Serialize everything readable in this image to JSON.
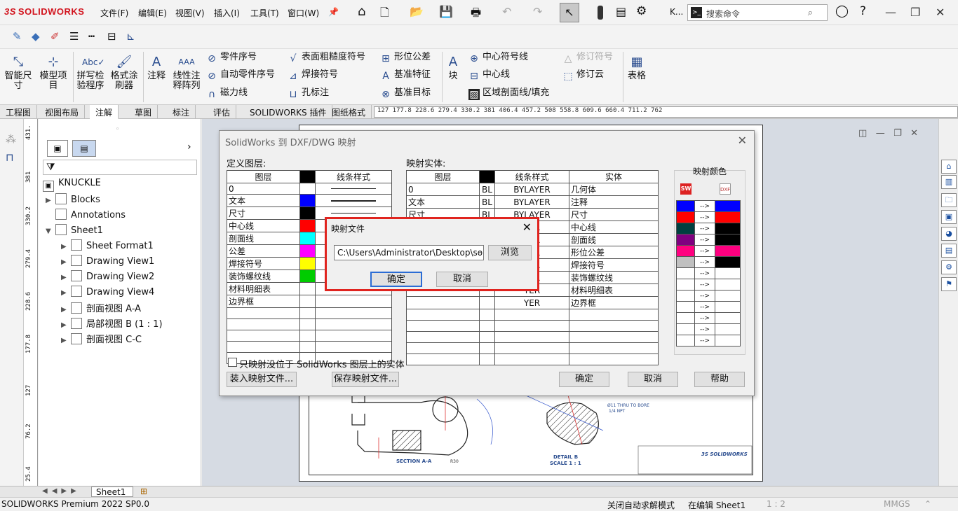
{
  "app": {
    "logo": "SOLIDWORKS",
    "logo_mark": "3S"
  },
  "menus": [
    "文件(F)",
    "编辑(E)",
    "视图(V)",
    "插入(I)",
    "工具(T)",
    "窗口(W)"
  ],
  "toolbar": {
    "doc_short": "K..."
  },
  "search": {
    "placeholder": "搜索命令"
  },
  "ribbon": {
    "smart_dim": "智能尺\n寸",
    "model_items": "模型项\n目",
    "spell": "拼写检\n验程序",
    "format_painter": "格式涂\n刷器",
    "note": "注释",
    "linear_note": "线性注\n释阵列",
    "balloon": "零件序号",
    "auto_balloon": "自动零件序号",
    "magnetic_line": "磁力线",
    "surface_finish": "表面粗糙度符号",
    "weld": "焊接符号",
    "hole_callout": "孔标注",
    "gtol": "形位公差",
    "datum_feature": "基准特征",
    "datum_target": "基准目标",
    "block": "块",
    "center_mark": "中心符号线",
    "centerline": "中心线",
    "area_hatch": "区域剖面线/填充",
    "revision_symbol": "修订符号",
    "revision_cloud": "修订云",
    "table": "表格"
  },
  "cmd_tabs": [
    "工程图",
    "视图布局",
    "注解",
    "草图",
    "标注",
    "评估",
    "SOLIDWORKS 插件",
    "图纸格式"
  ],
  "active_tab_index": 2,
  "hruler_text": "127      177.8      228.6      279.4      330.2      381 406.4      457.2      508      558.8      609.6      660.4      711.2      762",
  "vruler_labels": [
    "431.",
    "381",
    "330.2",
    "279.4",
    "228.6",
    "177.8",
    "127",
    "76.2",
    "25.4"
  ],
  "tree": {
    "root": "KNUCKLE",
    "items": [
      {
        "label": "Blocks",
        "level": 1,
        "expander": "▶",
        "icon": "folder-icon"
      },
      {
        "label": "Annotations",
        "level": 1,
        "expander": "",
        "icon": "annotation-icon"
      },
      {
        "label": "Sheet1",
        "level": 1,
        "expander": "▼",
        "icon": "sheet-icon"
      },
      {
        "label": "Sheet Format1",
        "level": 2,
        "expander": "▶",
        "icon": "sheet-format-icon"
      },
      {
        "label": "Drawing View1",
        "level": 2,
        "expander": "▶",
        "icon": "drawing-view-icon"
      },
      {
        "label": "Drawing View2",
        "level": 2,
        "expander": "▶",
        "icon": "drawing-view-icon"
      },
      {
        "label": "Drawing View4",
        "level": 2,
        "expander": "▶",
        "icon": "drawing-view-icon"
      },
      {
        "label": "剖面视图 A-A",
        "level": 2,
        "expander": "▶",
        "icon": "section-view-icon"
      },
      {
        "label": "局部视图 B (1 : 1)",
        "level": 2,
        "expander": "▶",
        "icon": "detail-view-icon"
      },
      {
        "label": "剖面视图 C-C",
        "level": 2,
        "expander": "▶",
        "icon": "section-view-icon"
      }
    ]
  },
  "dxf_dialog": {
    "title": "SolidWorks 到 DXF/DWG 映射",
    "define_layers": "定义图层:",
    "layers_headers": [
      "图层",
      "",
      "线条样式"
    ],
    "layers": [
      {
        "name": "0",
        "color": "#ffffff"
      },
      {
        "name": "文本",
        "color": "#0000ff"
      },
      {
        "name": "尺寸",
        "color": "#000000"
      },
      {
        "name": "中心线",
        "color": "#ff0000"
      },
      {
        "name": "剖面线",
        "color": "#00ffff"
      },
      {
        "name": "公差",
        "color": "#ff00ff"
      },
      {
        "name": "焊接符号",
        "color": "#ffff00"
      },
      {
        "name": "装饰螺纹线",
        "color": "#00cc00"
      },
      {
        "name": "材料明细表",
        "color": "#ffffff"
      },
      {
        "name": "边界框",
        "color": "#ffffff"
      }
    ],
    "map_entities": "映射实体:",
    "entity_headers": [
      "图层",
      "",
      "线条样式",
      "实体"
    ],
    "entities": [
      {
        "layer": "0",
        "color": "BL",
        "style": "BYLAYER",
        "entity": "几何体"
      },
      {
        "layer": "文本",
        "color": "BL",
        "style": "BYLAYER",
        "entity": "注释"
      },
      {
        "layer": "尺寸",
        "color": "BL",
        "style": "BYLAYER",
        "entity": "尺寸"
      },
      {
        "layer": "",
        "color": "",
        "style": "YER",
        "entity": "中心线"
      },
      {
        "layer": "",
        "color": "",
        "style": "YER",
        "entity": "剖面线"
      },
      {
        "layer": "",
        "color": "",
        "style": "YER",
        "entity": "形位公差"
      },
      {
        "layer": "",
        "color": "",
        "style": "YER",
        "entity": "焊接符号"
      },
      {
        "layer": "",
        "color": "",
        "style": "YER",
        "entity": "装饰螺纹线"
      },
      {
        "layer": "",
        "color": "",
        "style": "YER",
        "entity": "材料明细表"
      },
      {
        "layer": "",
        "color": "",
        "style": "YER",
        "entity": "边界框"
      }
    ],
    "map_colors_title": "映射颜色",
    "color_map": [
      {
        "from": "#0000ff",
        "to": "#0000ff"
      },
      {
        "from": "#ff0000",
        "to": "#ff0000"
      },
      {
        "from": "#004040",
        "to": "#000000"
      },
      {
        "from": "#800080",
        "to": "#000000"
      },
      {
        "from": "#ff0080",
        "to": "#ff0080"
      },
      {
        "from": "#c0c0c0",
        "to": "#000000"
      },
      {
        "from": "#ffffff",
        "to": "#ffffff"
      },
      {
        "from": "#ffffff",
        "to": "#ffffff"
      },
      {
        "from": "#ffffff",
        "to": "#ffffff"
      },
      {
        "from": "#ffffff",
        "to": "#ffffff"
      },
      {
        "from": "#ffffff",
        "to": "#ffffff"
      },
      {
        "from": "#ffffff",
        "to": "#ffffff"
      },
      {
        "from": "#ffffff",
        "to": "#ffffff"
      }
    ],
    "arrow": "-->",
    "checkbox_label": "只映射没位于 SolidWorks 图层上的实体",
    "load_btn": "装入映射文件...",
    "save_btn": "保存映射文件...",
    "ok": "确定",
    "cancel": "取消",
    "help": "帮助"
  },
  "map_file_dialog": {
    "title": "映射文件",
    "path": "C:\\Users\\Administrator\\Desktop\\solid",
    "browse": "浏览",
    "ok": "确定",
    "cancel": "取消"
  },
  "drawing": {
    "section_label": "SECTION A-A",
    "detail_label": "DETAIL B",
    "detail_scale": "SCALE 1 : 1",
    "note1": "Ø11 THRU TO BORE",
    "note2": "1/4 NPT",
    "dim_r": "R30",
    "tb_logo": "3S SOLIDWORKS"
  },
  "sheet_tab": "Sheet1",
  "status": {
    "product": "SOLIDWORKS Premium 2022 SP0.0",
    "auto_solve": "关闭自动求解模式",
    "editing": "在编辑 Sheet1",
    "scale": "1 : 2",
    "units": "MMGS"
  }
}
